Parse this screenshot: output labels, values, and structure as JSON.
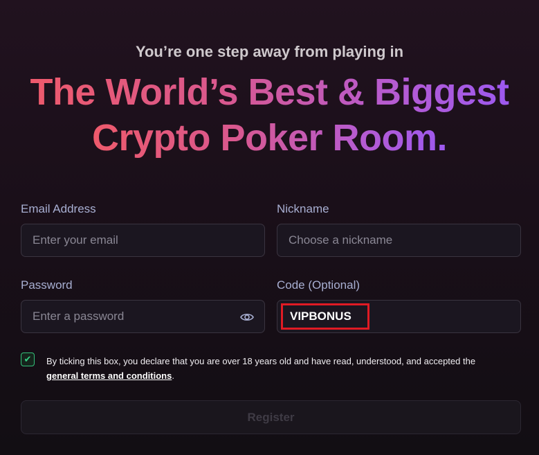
{
  "hero": {
    "subtitle": "You’re one step away from playing in",
    "headline_line1": "The World’s Best & Biggest",
    "headline_line2": "Crypto Poker Room."
  },
  "form": {
    "email": {
      "label": "Email Address",
      "placeholder": "Enter your email",
      "value": ""
    },
    "nickname": {
      "label": "Nickname",
      "placeholder": "Choose a nickname",
      "value": ""
    },
    "password": {
      "label": "Password",
      "placeholder": "Enter a password",
      "value": "",
      "toggle_icon": "eye-icon"
    },
    "code": {
      "label": "Code (Optional)",
      "value": "VIPBONUS",
      "highlight_color": "#e01b24"
    },
    "terms": {
      "checked": true,
      "text": "By ticking this box, you declare that you are over 18 years old and have read, understood, and accepted the",
      "link_text": "general terms and conditions",
      "suffix": "."
    },
    "register_label": "Register"
  },
  "colors": {
    "gradient_start": "#ee5a6c",
    "gradient_end": "#9d59f0",
    "label": "#a8afd2",
    "check": "#35d084"
  }
}
